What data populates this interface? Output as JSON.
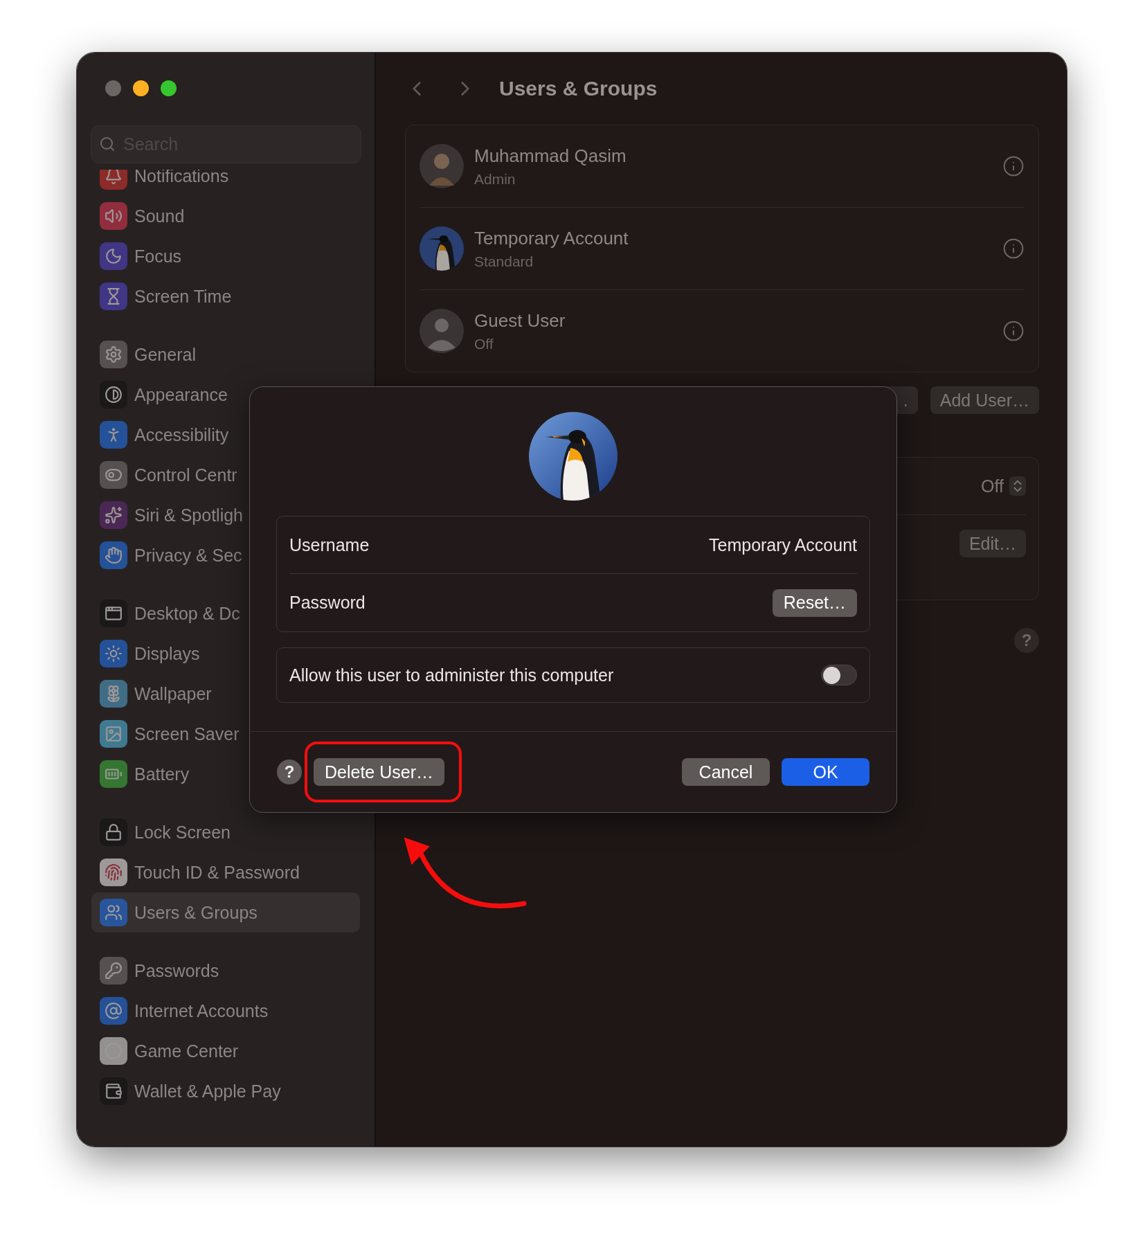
{
  "sidebar": {
    "search": {
      "placeholder": "Search"
    },
    "groups": [
      {
        "items": [
          {
            "label": "Notifications",
            "selected": false
          },
          {
            "label": "Sound",
            "selected": false
          },
          {
            "label": "Focus",
            "selected": false
          },
          {
            "label": "Screen Time",
            "selected": false
          }
        ]
      },
      {
        "items": [
          {
            "label": "General",
            "selected": false
          },
          {
            "label": "Appearance",
            "selected": false
          },
          {
            "label": "Accessibility",
            "selected": false
          },
          {
            "label": "Control Centr",
            "selected": false
          },
          {
            "label": "Siri & Spotligh",
            "selected": false
          },
          {
            "label": "Privacy & Sec",
            "selected": false
          }
        ]
      },
      {
        "items": [
          {
            "label": "Desktop & Dc",
            "selected": false
          },
          {
            "label": "Displays",
            "selected": false
          },
          {
            "label": "Wallpaper",
            "selected": false
          },
          {
            "label": "Screen Saver",
            "selected": false
          },
          {
            "label": "Battery",
            "selected": false
          }
        ]
      },
      {
        "items": [
          {
            "label": "Lock Screen",
            "selected": false
          },
          {
            "label": "Touch ID & Password",
            "selected": false
          },
          {
            "label": "Users & Groups",
            "selected": true
          }
        ]
      },
      {
        "items": [
          {
            "label": "Passwords",
            "selected": false
          },
          {
            "label": "Internet Accounts",
            "selected": false
          },
          {
            "label": "Game Center",
            "selected": false
          },
          {
            "label": "Wallet & Apple Pay",
            "selected": false
          }
        ]
      }
    ]
  },
  "content": {
    "title": "Users & Groups",
    "users": [
      {
        "name": "Muhammad Qasim",
        "role": "Admin"
      },
      {
        "name": "Temporary Account",
        "role": "Standard"
      },
      {
        "name": "Guest User",
        "role": "Off"
      }
    ],
    "partial_button": ".",
    "add_user_button": "Add User…",
    "settings_rows": [
      {
        "kind": "popup",
        "value": "Off"
      },
      {
        "kind": "button",
        "label": "Edit…"
      }
    ],
    "help_button": "?"
  },
  "dialog": {
    "fields": [
      {
        "kind": "text",
        "label": "Username",
        "value": "Temporary Account"
      },
      {
        "kind": "button",
        "label": "Password",
        "button": "Reset…"
      }
    ],
    "admin_toggle": {
      "label": "Allow this user to administer this computer",
      "on": false
    },
    "help_button": "?",
    "delete_button": "Delete User…",
    "cancel_button": "Cancel",
    "ok_button": "OK"
  }
}
